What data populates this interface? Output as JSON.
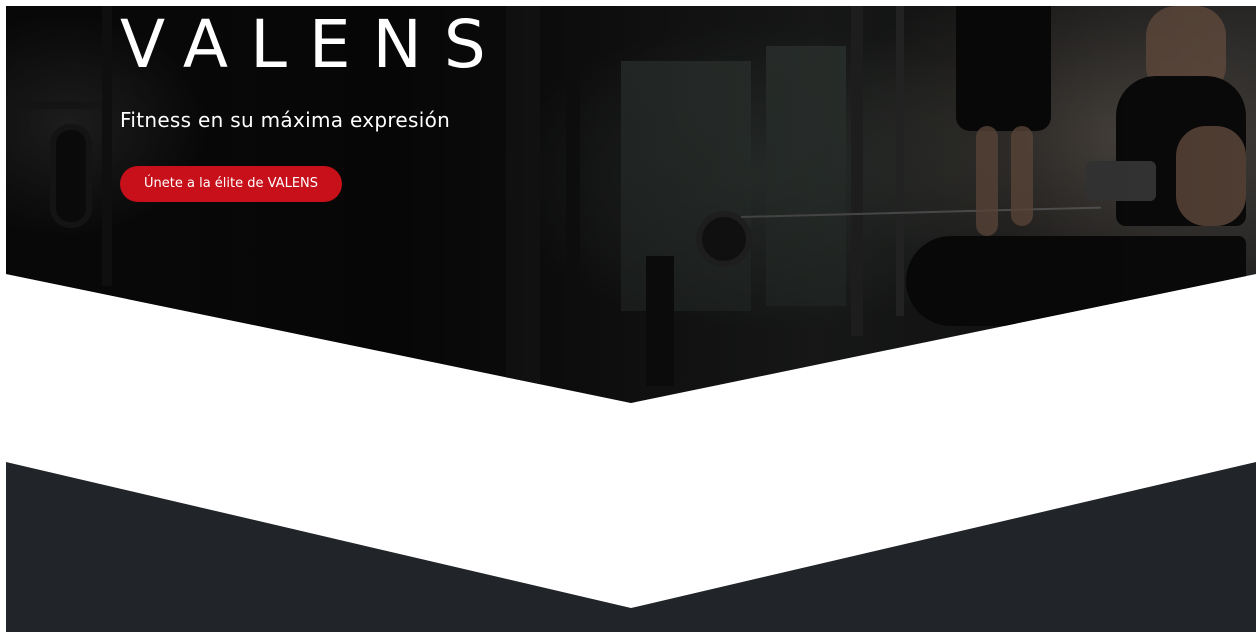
{
  "hero": {
    "brand": "VALENS",
    "tagline": "Fitness en su máxima expresión",
    "cta_label": "Únete a la élite de VALENS"
  },
  "colors": {
    "accent": "#c8101b",
    "dark_section": "#212428",
    "background": "#ffffff"
  },
  "icons": {
    "hero_image": "gym-photo"
  }
}
